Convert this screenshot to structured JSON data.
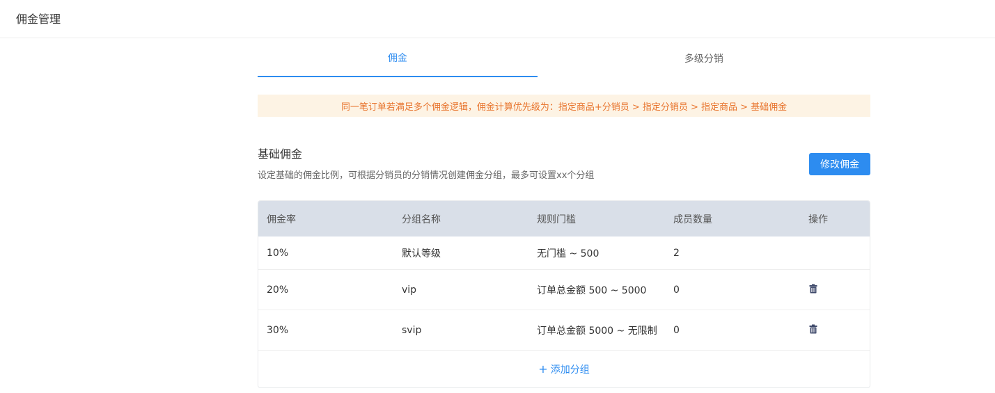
{
  "header": {
    "title": "佣金管理"
  },
  "tabs": [
    {
      "label": "佣金",
      "active": true
    },
    {
      "label": "多级分销",
      "active": false
    }
  ],
  "notice": "同一笔订单若满足多个佣金逻辑，佣金计算优先级为：指定商品+分销员 > 指定分销员 > 指定商品 > 基础佣金",
  "section": {
    "title": "基础佣金",
    "description": "设定基础的佣金比例，可根据分销员的分销情况创建佣金分组，最多可设置xx个分组",
    "edit_label": "修改佣金"
  },
  "table": {
    "headers": [
      "佣金率",
      "分组名称",
      "规则门槛",
      "成员数量",
      "操作"
    ],
    "rows": [
      {
        "rate": "10%",
        "name": "默认等级",
        "rule": "无门槛 ~ 500",
        "members": "2",
        "deletable": false
      },
      {
        "rate": "20%",
        "name": "vip",
        "rule": "订单总金额 500 ~ 5000",
        "members": "0",
        "deletable": true
      },
      {
        "rate": "30%",
        "name": "svip",
        "rule": "订单总金额 5000 ~ 无限制",
        "members": "0",
        "deletable": true
      }
    ],
    "add_label": "添加分组"
  },
  "colors": {
    "accent": "#2d8cf0",
    "notice_bg": "#fdf3e4",
    "notice_text": "#e8742d",
    "table_header_bg": "#d9dfe8"
  },
  "icons": {
    "delete": "trash-icon",
    "add": "plus-icon"
  }
}
